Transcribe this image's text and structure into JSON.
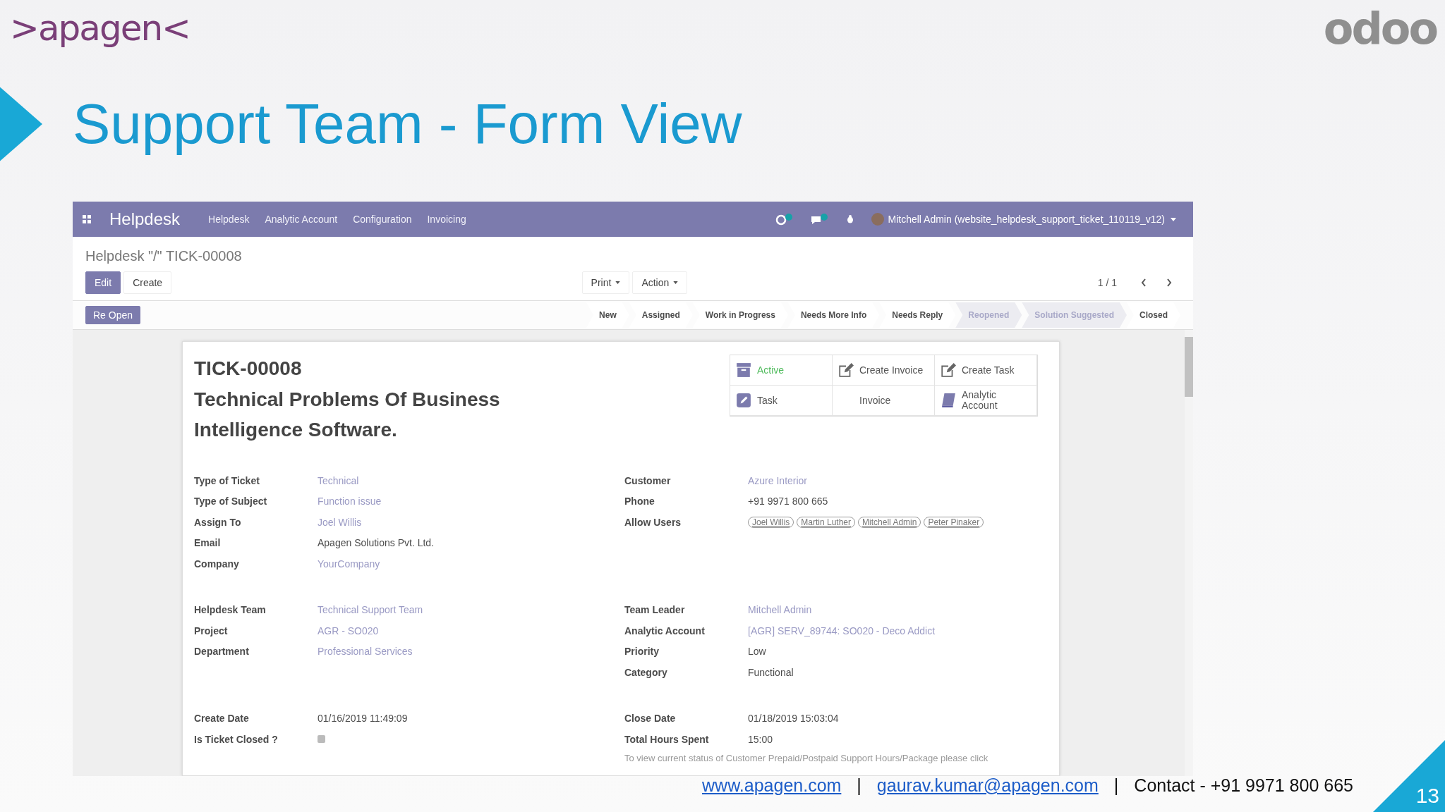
{
  "slide": {
    "brand": ">apagen<",
    "partner_logo": "odoo",
    "title": "Support Team - Form View",
    "page_number": "13",
    "footer": [
      {
        "kind": "link",
        "text": "www.apagen.com"
      },
      {
        "kind": "separator",
        "text": "|"
      },
      {
        "kind": "link",
        "text": "gaurav.kumar@apagen.com"
      },
      {
        "kind": "separator",
        "text": "|"
      },
      {
        "kind": "text",
        "text": "Contact - +91 9971 800 665"
      }
    ]
  },
  "navbar": {
    "app": "Helpdesk",
    "menus": [
      "Helpdesk",
      "Analytic Account",
      "Configuration",
      "Invoicing"
    ],
    "user": "Mitchell Admin (website_helpdesk_support_ticket_110119_v12)"
  },
  "breadcrumb": "Helpdesk \"/\" TICK-00008",
  "buttons": [
    {
      "label": "Edit",
      "primary": true
    },
    {
      "label": "Create",
      "primary": false
    }
  ],
  "dropdowns": [
    "Print",
    "Action"
  ],
  "pager": "1 / 1",
  "reopen_button": "Re Open",
  "stages": [
    {
      "label": "New",
      "muted": false
    },
    {
      "label": "Assigned",
      "muted": false
    },
    {
      "label": "Work in Progress",
      "muted": false
    },
    {
      "label": "Needs More Info",
      "muted": false
    },
    {
      "label": "Needs Reply",
      "muted": false
    },
    {
      "label": "Reopened",
      "muted": true
    },
    {
      "label": "Solution Suggested",
      "muted": true
    },
    {
      "label": "Closed",
      "muted": false
    }
  ],
  "record": {
    "number": "TICK-00008",
    "name": "Technical Problems Of Business Intelligence Software.",
    "smart_buttons": [
      {
        "kind": "archive",
        "label": "Active"
      },
      {
        "kind": "edit",
        "label": "Create Invoice"
      },
      {
        "kind": "edit",
        "label": "Create Task"
      },
      {
        "kind": "task",
        "label": "Task"
      },
      {
        "kind": "plain",
        "label": "Invoice"
      },
      {
        "kind": "book",
        "label": "Analytic Account"
      }
    ],
    "sections": [
      {
        "left": [
          {
            "kind": "text",
            "label": "Type of Ticket",
            "value": "Technical",
            "link": true
          },
          {
            "kind": "text",
            "label": "Type of Subject",
            "value": "Function issue",
            "link": true
          },
          {
            "kind": "text",
            "label": "Assign To",
            "value": "Joel Willis",
            "link": true
          },
          {
            "kind": "text",
            "label": "Email",
            "value": "Apagen Solutions Pvt. Ltd.",
            "link": false
          },
          {
            "kind": "text",
            "label": "Company",
            "value": "YourCompany",
            "link": true
          }
        ],
        "right": [
          {
            "kind": "text",
            "label": "Customer",
            "value": "Azure Interior",
            "link": true
          },
          {
            "kind": "text",
            "label": "Phone",
            "value": "+91 9971 800 665",
            "link": false
          },
          {
            "kind": "tags",
            "label": "Allow Users",
            "tags": [
              "Joel Willis",
              "Martin Luther",
              "Mitchell Admin",
              "Peter Pinaker"
            ]
          }
        ]
      },
      {
        "left": [
          {
            "kind": "text",
            "label": "Helpdesk Team",
            "value": "Technical Support Team",
            "link": true
          },
          {
            "kind": "text",
            "label": "Project",
            "value": "AGR - SO020",
            "link": true
          },
          {
            "kind": "text",
            "label": "Department",
            "value": "Professional Services",
            "link": true
          }
        ],
        "right": [
          {
            "kind": "text",
            "label": "Team Leader",
            "value": "Mitchell Admin",
            "link": true
          },
          {
            "kind": "text",
            "label": "Analytic Account",
            "value": "[AGR] SERV_89744: SO020 - Deco Addict",
            "link": true
          },
          {
            "kind": "text",
            "label": "Priority",
            "value": "Low",
            "link": false
          },
          {
            "kind": "text",
            "label": "Category",
            "value": "Functional",
            "link": false
          }
        ]
      },
      {
        "left": [
          {
            "kind": "text",
            "label": "Create Date",
            "value": "01/16/2019 11:49:09",
            "link": false
          },
          {
            "kind": "checkbox",
            "label": "Is Ticket Closed ?",
            "checked": false
          }
        ],
        "right": [
          {
            "kind": "text",
            "label": "Close Date",
            "value": "01/18/2019 15:03:04",
            "link": false
          },
          {
            "kind": "text",
            "label": "Total Hours Spent",
            "value": "15:00",
            "link": false
          }
        ],
        "note": "To view current status of Customer Prepaid/Postpaid Support Hours/Package please click"
      }
    ]
  }
}
